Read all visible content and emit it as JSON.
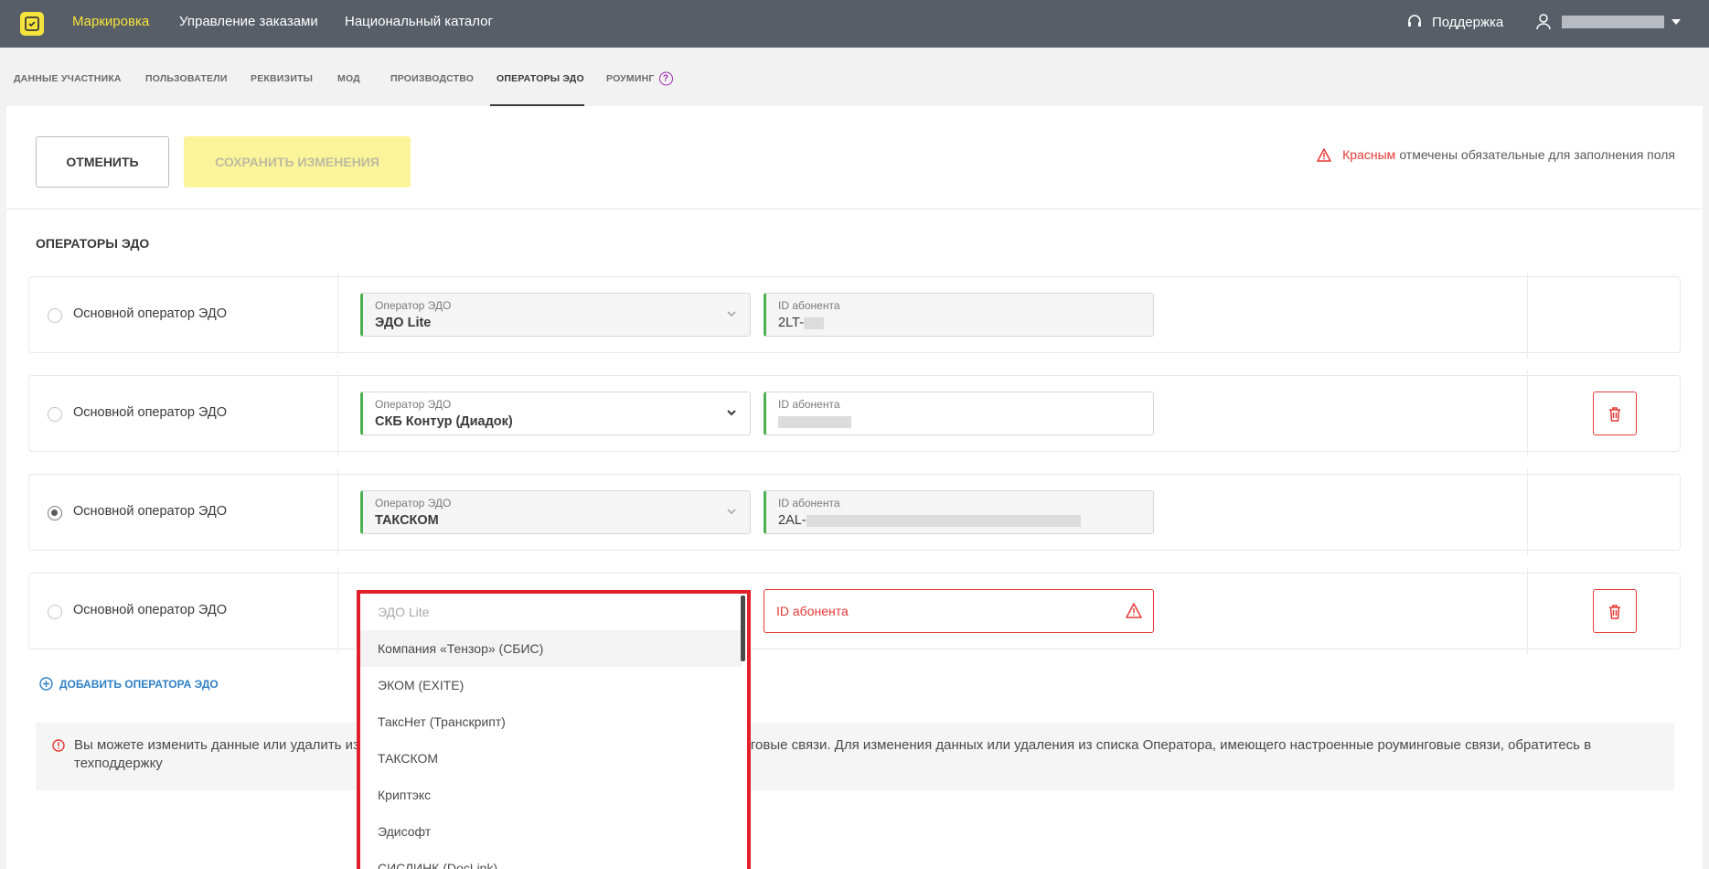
{
  "topbar": {
    "nav": [
      "Маркировка",
      "Управление заказами",
      "Национальный каталог"
    ],
    "support": "Поддержка"
  },
  "tabs": [
    "ДАННЫЕ УЧАСТНИКА",
    "ПОЛЬЗОВАТЕЛИ",
    "РЕКВИЗИТЫ",
    "МОД",
    "ПРОИЗВОДСТВО",
    "ОПЕРАТОРЫ ЭДО",
    "РОУМИНГ"
  ],
  "active_tab": "ОПЕРАТОРЫ ЭДО",
  "toolbar": {
    "cancel_label": "ОТМЕНИТЬ",
    "save_label": "СОХРАНИТЬ ИЗМЕНЕНИЯ",
    "required_red": "Красным",
    "required_rest": "отмечены обязательные для заполнения поля"
  },
  "section_title": "ОПЕРАТОРЫ ЭДО",
  "rows": [
    {
      "radio_label": "Основной оператор ЭДО",
      "checked": false,
      "operator_label": "Оператор ЭДО",
      "operator_value": "ЭДО Lite",
      "id_label": "ID абонента",
      "id_value": "2LT-"
    },
    {
      "radio_label": "Основной оператор ЭДО",
      "checked": false,
      "operator_label": "Оператор ЭДО",
      "operator_value": "СКБ Контур (Диадок)",
      "id_label": "ID абонента",
      "id_value": ""
    },
    {
      "radio_label": "Основной оператор ЭДО",
      "checked": true,
      "operator_label": "Оператор ЭДО",
      "operator_value": "ТАКСКОМ",
      "id_label": "ID абонента",
      "id_value": "2AL-"
    },
    {
      "radio_label": "Основной оператор ЭДО",
      "checked": false,
      "id_label": "ID абонента"
    }
  ],
  "add_operator_label": "ДОБАВИТЬ ОПЕРАТОРА ЭДО",
  "info_text": "Вы можете изменить данные или удалить из списка Оператора ЭДО, если для него не настроены роуминговые связи. Для изменения данных или удаления из списка Оператора, имеющего настроенные роуминговые связи, обратитесь в техподдержку",
  "dropdown": {
    "options": [
      "ЭДО Lite",
      "Компания «Тензор» (СБИС)",
      "ЭКОМ (EXITE)",
      "ТаксНет (Транскрипт)",
      "ТАКСКОМ",
      "Криптэкс",
      "Эдисофт",
      "СИСЛИНК (DocLink)"
    ]
  },
  "colors": {
    "topbar": "#585e67",
    "brand_yellow": "#f6e43a",
    "accent_green": "#4cb050",
    "error_red": "#e53935",
    "link_blue": "#2f80c5"
  }
}
